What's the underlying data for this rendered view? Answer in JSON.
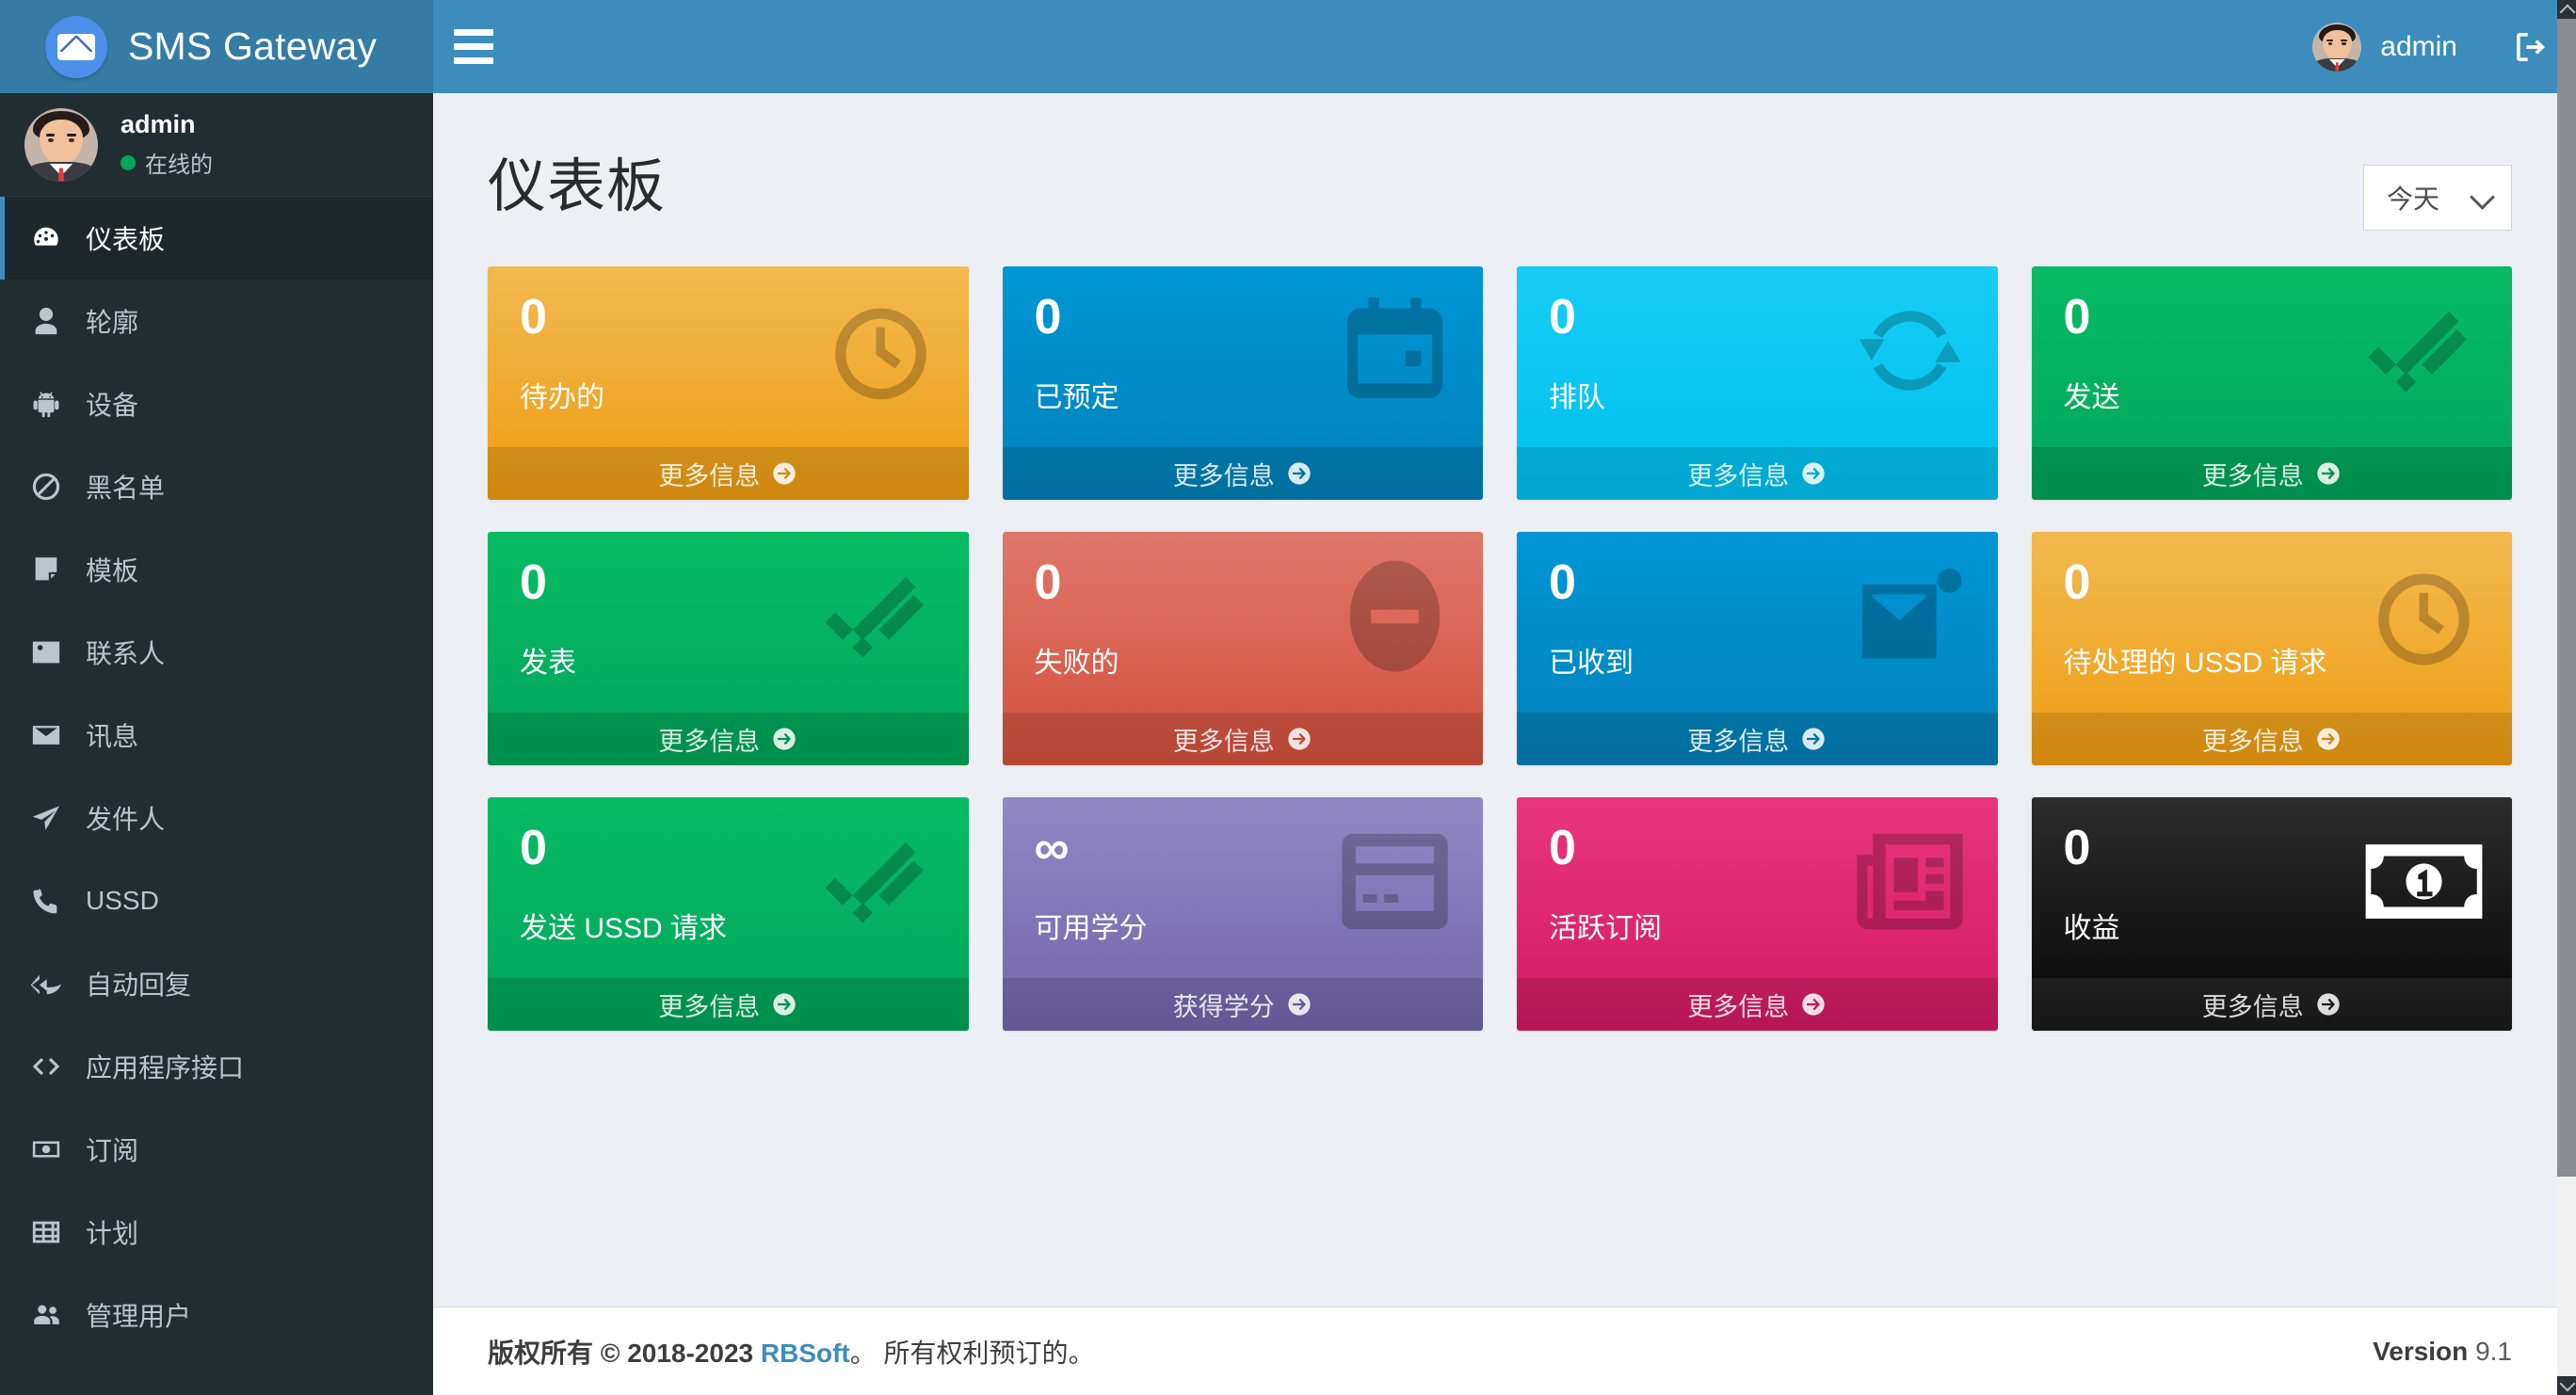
{
  "header": {
    "brand_title": "SMS Gateway",
    "brand_logo_icon": "envelope-icon",
    "hamburger_icon": "hamburger-menu-icon",
    "user_name": "admin",
    "logout_icon": "logout-icon"
  },
  "sidebar": {
    "user": {
      "name": "admin",
      "status": "在线的"
    },
    "items": [
      {
        "label": "仪表板",
        "icon": "dashboard-icon",
        "active": true
      },
      {
        "label": "轮廓",
        "icon": "user-icon",
        "active": false
      },
      {
        "label": "设备",
        "icon": "android-icon",
        "active": false
      },
      {
        "label": "黑名单",
        "icon": "ban-icon",
        "active": false
      },
      {
        "label": "模板",
        "icon": "note-icon",
        "active": false
      },
      {
        "label": "联系人",
        "icon": "contact-card-icon",
        "active": false
      },
      {
        "label": "讯息",
        "icon": "envelope-icon",
        "active": false
      },
      {
        "label": "发件人",
        "icon": "paper-plane-icon",
        "active": false
      },
      {
        "label": "USSD",
        "icon": "phone-icon",
        "active": false
      },
      {
        "label": "自动回复",
        "icon": "reply-all-icon",
        "active": false
      },
      {
        "label": "应用程序接口",
        "icon": "code-icon",
        "active": false
      },
      {
        "label": "订阅",
        "icon": "money-icon",
        "active": false
      },
      {
        "label": "计划",
        "icon": "table-icon",
        "active": false
      },
      {
        "label": "管理用户",
        "icon": "users-icon",
        "active": false
      }
    ]
  },
  "main": {
    "page_title": "仪表板",
    "period_filter": {
      "selected": "今天",
      "icon": "chevron-down-icon"
    },
    "cards": [
      {
        "value": "0",
        "label": "待办的",
        "link": "更多信息",
        "color": "#f39c12",
        "theme": "c-yellow",
        "icon": "stopwatch-icon"
      },
      {
        "value": "0",
        "label": "已预定",
        "link": "更多信息",
        "color": "#0082ba",
        "theme": "c-blue",
        "icon": "calendar-icon"
      },
      {
        "value": "0",
        "label": "排队",
        "link": "更多信息",
        "color": "#00c0ef",
        "theme": "c-aqua",
        "icon": "refresh-cycle-icon"
      },
      {
        "value": "0",
        "label": "发送",
        "link": "更多信息",
        "color": "#00a65a",
        "theme": "c-green",
        "icon": "double-check-icon"
      },
      {
        "value": "0",
        "label": "发表",
        "link": "更多信息",
        "color": "#00a65a",
        "theme": "c-green",
        "icon": "double-check-icon"
      },
      {
        "value": "0",
        "label": "失败的",
        "link": "更多信息",
        "color": "#d24f3c",
        "theme": "c-red",
        "icon": "minus-circle-icon"
      },
      {
        "value": "0",
        "label": "已收到",
        "link": "更多信息",
        "color": "#0082ba",
        "theme": "c-blue",
        "icon": "envelope-open-icon"
      },
      {
        "value": "0",
        "label": "待处理的 USSD 请求",
        "link": "更多信息",
        "color": "#f39c12",
        "theme": "c-yellow",
        "icon": "stopwatch-icon"
      },
      {
        "value": "0",
        "label": "发送 USSD 请求",
        "link": "更多信息",
        "color": "#00a65a",
        "theme": "c-green",
        "icon": "double-check-icon"
      },
      {
        "value": "∞",
        "label": "可用学分",
        "link": "获得学分",
        "color": "#7265ab",
        "theme": "c-purple",
        "icon": "credit-card-icon"
      },
      {
        "value": "0",
        "label": "活跃订阅",
        "link": "更多信息",
        "color": "#d31a63",
        "theme": "c-pink",
        "icon": "newspaper-icon"
      },
      {
        "value": "0",
        "label": "收益",
        "link": "更多信息",
        "color": "#060606",
        "theme": "c-black",
        "icon": "money-bill-icon"
      }
    ],
    "card_link_arrow_icon": "arrow-circle-right-icon"
  },
  "footer": {
    "copyright_prefix": "版权所有 © 2018-2023 ",
    "company": "RBSoft",
    "copyright_suffix": "。 所有权利预订的。",
    "version_label": "Version",
    "version_number": "9.1"
  }
}
